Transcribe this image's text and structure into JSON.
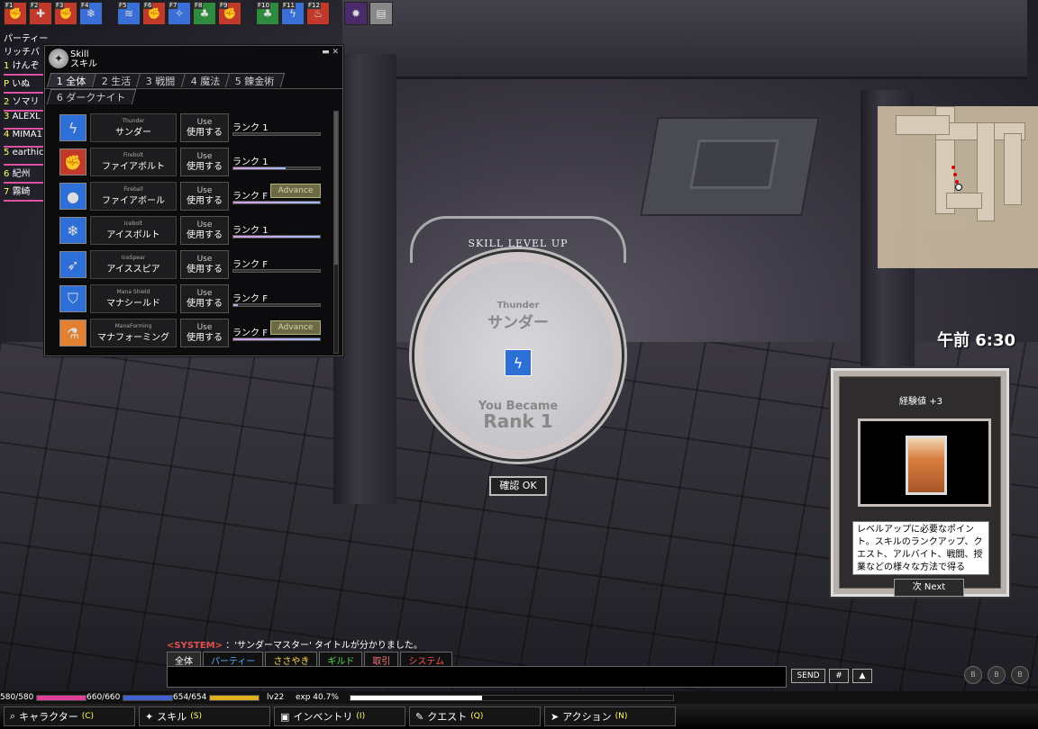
{
  "hotkeys": [
    {
      "key": "F1",
      "icon": "fire-fist-icon",
      "color": "#c0392b"
    },
    {
      "key": "F2",
      "icon": "shield-cross-icon",
      "color": "#c0392b"
    },
    {
      "key": "F3",
      "icon": "fire-fist-icon",
      "color": "#c0392b"
    },
    {
      "key": "F4",
      "icon": "ice-icon",
      "color": "#3a6fd8"
    },
    {
      "key": "F5",
      "icon": "wave-icon",
      "color": "#3a6fd8"
    },
    {
      "key": "F6",
      "icon": "fire-fist-icon",
      "color": "#c0392b"
    },
    {
      "key": "F7",
      "icon": "magic-icon",
      "color": "#3a6fd8"
    },
    {
      "key": "F8",
      "icon": "herb-icon",
      "color": "#2e8b3e"
    },
    {
      "key": "F9",
      "icon": "fire-fist-icon",
      "color": "#c0392b"
    },
    {
      "key": "F10",
      "icon": "herb-icon",
      "color": "#2e8b3e"
    },
    {
      "key": "F11",
      "icon": "thunder-icon",
      "color": "#3a6fd8"
    },
    {
      "key": "F12",
      "icon": "flame-icon",
      "color": "#c0392b"
    },
    {
      "key": "",
      "icon": "dark-knight-icon",
      "color": "#4a2a6a"
    },
    {
      "key": "",
      "icon": "book-icon",
      "color": "#888888"
    }
  ],
  "party": {
    "title": "パーティー",
    "subtitle": "リッチバ",
    "members": [
      {
        "num": "1",
        "name": "けんぞ"
      },
      {
        "num": "P",
        "name": "いぬ"
      },
      {
        "num": "2",
        "name": "ソマリ"
      },
      {
        "num": "3",
        "name": "ALEXL"
      },
      {
        "num": "4",
        "name": "MIMA1"
      },
      {
        "num": "5",
        "name": "earthic"
      },
      {
        "num": "6",
        "name": "紀州"
      },
      {
        "num": "7",
        "name": "霧崎"
      }
    ]
  },
  "skill_window": {
    "title_en": "Skill",
    "title_ja": "スキル",
    "controls": "▬ ✕",
    "tabs": [
      "1 全体",
      "2 生活",
      "3 戦闘",
      "4 魔法",
      "5 錬金術"
    ],
    "tab2": "6 ダークナイト",
    "use_en": "Use",
    "use_ja": "使用する",
    "rank_prefix": "ランク",
    "skills": [
      {
        "en": "Thunder",
        "ja": "サンダー",
        "rank": "1",
        "bar": 0.0,
        "advance": "",
        "icon": "thunder-icon",
        "color": "#2d6fd6"
      },
      {
        "en": "Firebolt",
        "ja": "ファイアボルト",
        "rank": "1",
        "bar": 0.6,
        "advance": "",
        "icon": "fire-fist-icon",
        "color": "#c0392b"
      },
      {
        "en": "Fireball",
        "ja": "ファイアボール",
        "rank": "F",
        "bar": 1.0,
        "advance": "Advance",
        "icon": "fireball-icon",
        "color": "#2d6fd6"
      },
      {
        "en": "Icebolt",
        "ja": "アイスボルト",
        "rank": "1",
        "bar": 1.0,
        "advance": "",
        "icon": "ice-icon",
        "color": "#2d6fd6"
      },
      {
        "en": "IceSpear",
        "ja": "アイススピア",
        "rank": "F",
        "bar": 0.0,
        "advance": "",
        "icon": "ice-spear-icon",
        "color": "#2d6fd6"
      },
      {
        "en": "Mana Shield",
        "ja": "マナシールド",
        "rank": "F",
        "bar": 0.05,
        "advance": "",
        "icon": "shield-icon",
        "color": "#2d6fd6"
      },
      {
        "en": "ManaForming",
        "ja": "マナフォーミング",
        "rank": "F",
        "bar": 1.0,
        "advance": "Advance",
        "icon": "potion-icon",
        "color": "#e08030"
      }
    ]
  },
  "levelup": {
    "header": "SKILL LEVEL UP",
    "skill_en": "Thunder",
    "skill_ja": "サンダー",
    "became": "You Became",
    "rank": "Rank 1",
    "ok": "確認 OK"
  },
  "clock": "午前 6:30",
  "exp_panel": {
    "title": "経験値 +3",
    "desc": "レベルアップに必要なポイント。スキルのランクアップ、クエスト、アルバイト、戦闘、授業などの様々な方法で得る",
    "next": "次 Next"
  },
  "chat": {
    "system_tag": "<SYSTEM>",
    "system_msg": "：'サンダーマスター' タイトルが分かりました。",
    "tabs": [
      {
        "label": "全体",
        "color": "#ffffff"
      },
      {
        "label": "パーティー",
        "color": "#55aaff"
      },
      {
        "label": "ささやき",
        "color": "#ffdd44"
      },
      {
        "label": "ギルド",
        "color": "#55dd55"
      },
      {
        "label": "取引",
        "color": "#ff7777"
      },
      {
        "label": "システム",
        "color": "#ff5555"
      }
    ],
    "send": "SEND",
    "hash": "#",
    "up": "▲"
  },
  "status": {
    "hp": "580/580",
    "hp_frac": 1.0,
    "mp": "660/660",
    "mp_frac": 1.0,
    "sp": "654/654",
    "sp_frac": 1.0,
    "level": "lv22",
    "exp": "exp 40.7%",
    "exp_frac": 0.407
  },
  "menu": [
    {
      "label": "キャラクター",
      "key": "(C)",
      "icon": "search-icon"
    },
    {
      "label": "スキル",
      "key": "(S)",
      "icon": "skill-icon"
    },
    {
      "label": "インベントリ",
      "key": "(I)",
      "icon": "bag-icon"
    },
    {
      "label": "クエスト",
      "key": "(Q)",
      "icon": "quest-icon"
    },
    {
      "label": "アクション",
      "key": "(N)",
      "icon": "action-icon"
    }
  ],
  "bubbles": [
    "B",
    "B",
    "B"
  ]
}
